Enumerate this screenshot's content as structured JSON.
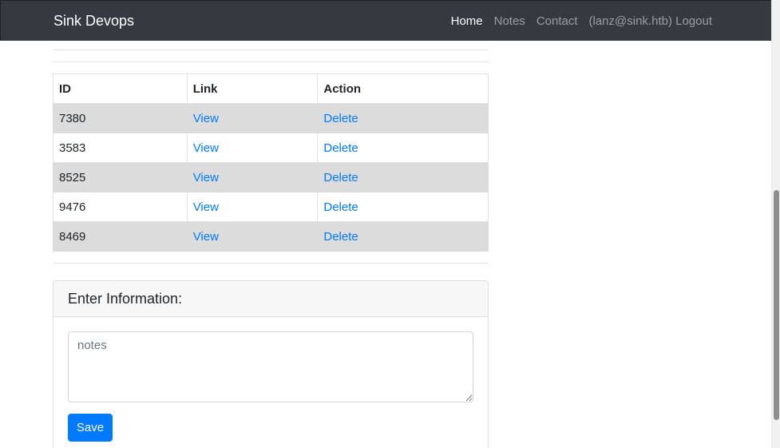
{
  "navbar": {
    "brand": "Sink Devops",
    "links": [
      {
        "label": "Home",
        "active": true
      },
      {
        "label": "Notes",
        "active": false
      },
      {
        "label": "Contact",
        "active": false
      },
      {
        "label": "(lanz@sink.htb) Logout",
        "active": false
      }
    ]
  },
  "table": {
    "headers": [
      "ID",
      "Link",
      "Action"
    ],
    "rows": [
      {
        "id": "7380",
        "link": "View",
        "action": "Delete"
      },
      {
        "id": "3583",
        "link": "View",
        "action": "Delete"
      },
      {
        "id": "8525",
        "link": "View",
        "action": "Delete"
      },
      {
        "id": "9476",
        "link": "View",
        "action": "Delete"
      },
      {
        "id": "8469",
        "link": "View",
        "action": "Delete"
      }
    ]
  },
  "form": {
    "title": "Enter Information:",
    "notes_placeholder": "notes",
    "notes_value": "",
    "save_label": "Save"
  },
  "colors": {
    "navbar_bg": "#343a40",
    "link": "#007bff",
    "primary_button": "#007bff",
    "striped_row": "#dcdcdc"
  }
}
